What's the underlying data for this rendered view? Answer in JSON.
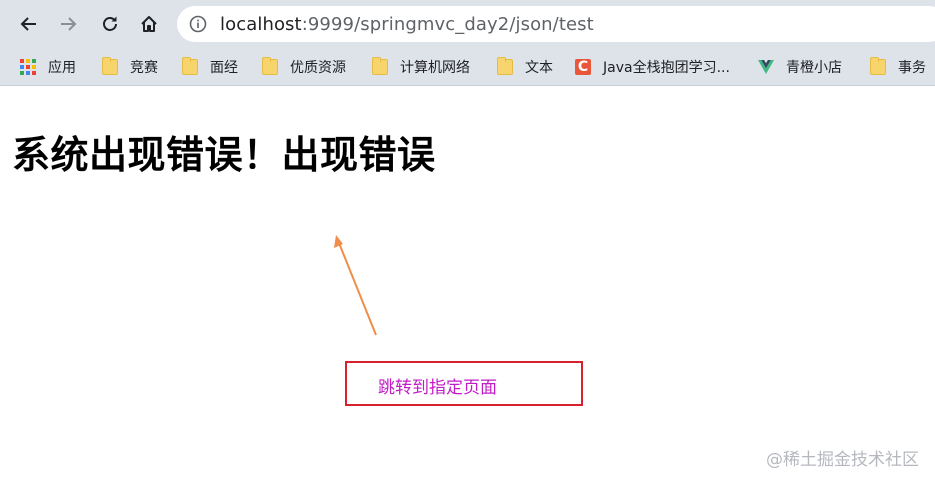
{
  "browser": {
    "url_host": "localhost",
    "url_path": ":9999/springmvc_day2/json/test",
    "icons": [
      "back-arrow-icon",
      "forward-arrow-icon",
      "reload-icon",
      "home-icon",
      "info-icon"
    ]
  },
  "bookmarks": [
    {
      "label": "应用",
      "icon": "apps-grid-icon"
    },
    {
      "label": "竞赛",
      "icon": "folder-icon"
    },
    {
      "label": "面经",
      "icon": "folder-icon"
    },
    {
      "label": "优质资源",
      "icon": "folder-icon"
    },
    {
      "label": "计算机网络",
      "icon": "folder-icon"
    },
    {
      "label": "文本",
      "icon": "folder-icon"
    },
    {
      "label": "Java全栈抱团学习...",
      "icon": "csdn-c-icon"
    },
    {
      "label": "青橙小店",
      "icon": "vue-logo-icon"
    },
    {
      "label": "事务",
      "icon": "folder-icon"
    }
  ],
  "page": {
    "heading": "系统出现错误！出现错误",
    "link_label": "跳转到指定页面",
    "watermark": "@稀土掘金技术社区",
    "csdn_letter": "C"
  },
  "colors": {
    "toolbar_bg": "#dee3ea",
    "arrow": "#f08d49",
    "box_border": "#d9202d",
    "link": "#c21bc8"
  }
}
